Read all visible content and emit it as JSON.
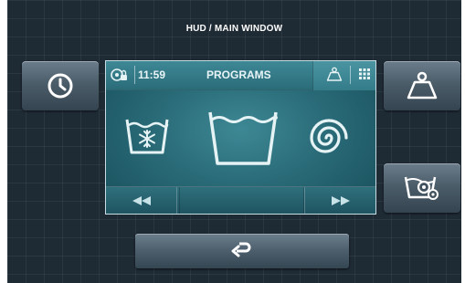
{
  "header": {
    "title": "HUD / MAIN WINDOW"
  },
  "screen": {
    "time": "11:59",
    "title": "PROGRAMS"
  },
  "icons": {
    "clock": "clock-icon",
    "weight": "weight-icon",
    "wash_settings": "wash-settings-icon",
    "back": "back-arrow-icon",
    "lock": "lock-icon",
    "grid": "grid-icon",
    "program_cold": "cold-wash-icon",
    "program_normal": "wash-tub-icon",
    "program_spin": "spin-icon",
    "prev": "rewind-icon",
    "next": "fast-forward-icon"
  },
  "colors": {
    "background": "#1e2a34",
    "screen": "#2a6b78",
    "icon_stroke": "#e6f3f5"
  }
}
